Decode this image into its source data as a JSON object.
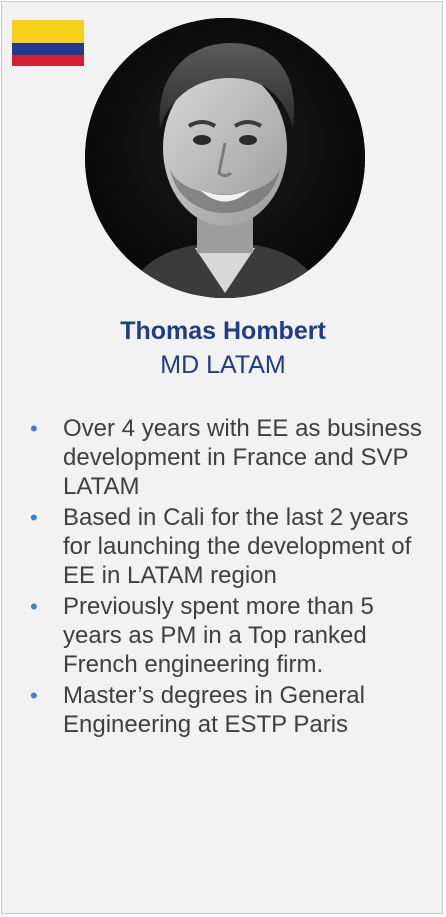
{
  "profile": {
    "name": "Thomas Hombert",
    "role": "MD LATAM"
  },
  "flag": {
    "country": "Colombia",
    "colors": [
      "#f7d117",
      "#1f3a93",
      "#d21f2f"
    ]
  },
  "bullets": [
    "Over 4 years with EE as business development in France and SVP LATAM",
    "Based in Cali for the last 2 years for launching the development of EE in LATAM region",
    "Previously spent more than 5 years as PM in a Top ranked French engineering firm.",
    "Master’s degrees in General Engineering at ESTP Paris"
  ],
  "colors": {
    "accent": "#1f3c88",
    "bullet_marker": "#2f87d8",
    "text": "#3f3f3f",
    "card_background": "#f2f2f2"
  }
}
